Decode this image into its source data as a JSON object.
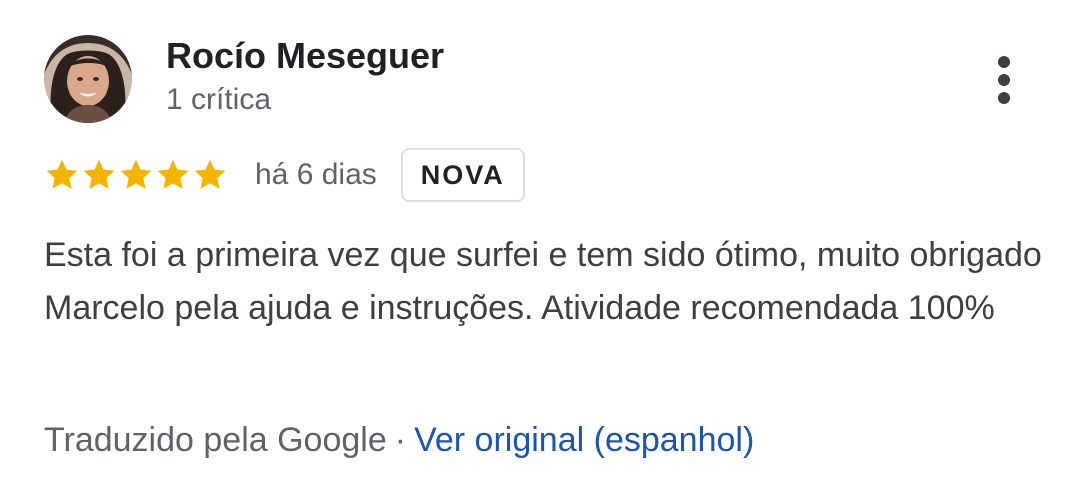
{
  "reviewer": {
    "name": "Rocío Meseguer",
    "review_count": "1 crítica"
  },
  "rating": {
    "stars": 5,
    "max_stars": 5,
    "star_color": "#f4b400",
    "date": "há 6 dias",
    "badge": "NOVA"
  },
  "review": {
    "text": "Esta foi a primeira vez que surfei e tem sido ótimo, muito obrigado Marcelo pela ajuda e instruções. Atividade recomendada 100%"
  },
  "translation": {
    "translated_by": "Traduzido pela Google",
    "separator": "·",
    "see_original": "Ver original (espanhol)",
    "link_color": "#1a56b0"
  },
  "icons": {
    "more_menu": "more-vertical-icon",
    "star": "star-icon"
  }
}
